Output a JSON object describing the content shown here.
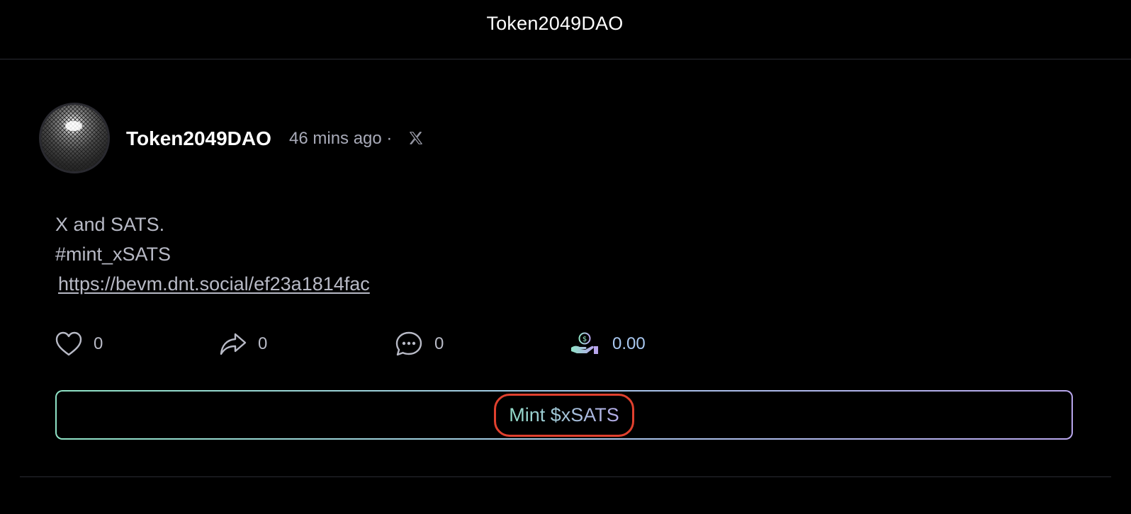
{
  "header": {
    "title": "Token2049DAO"
  },
  "post": {
    "author": "Token2049DAO",
    "timestamp": "46 mins ago",
    "separator": "·",
    "source_icon": "x-logo-icon",
    "body_lines": [
      "X and SATS.",
      "#mint_xSATS"
    ],
    "link": "https://bevm.dnt.social/ef23a1814fac",
    "actions": {
      "likes": "0",
      "shares": "0",
      "comments": "0",
      "tips": "0.00"
    },
    "mint_button_label": "Mint $xSATS"
  },
  "colors": {
    "background": "#000000",
    "muted_text": "#b8bac6",
    "gradient_start": "#8fe3c6",
    "gradient_end": "#b8a6ec",
    "highlight_ring": "#e0402e"
  }
}
